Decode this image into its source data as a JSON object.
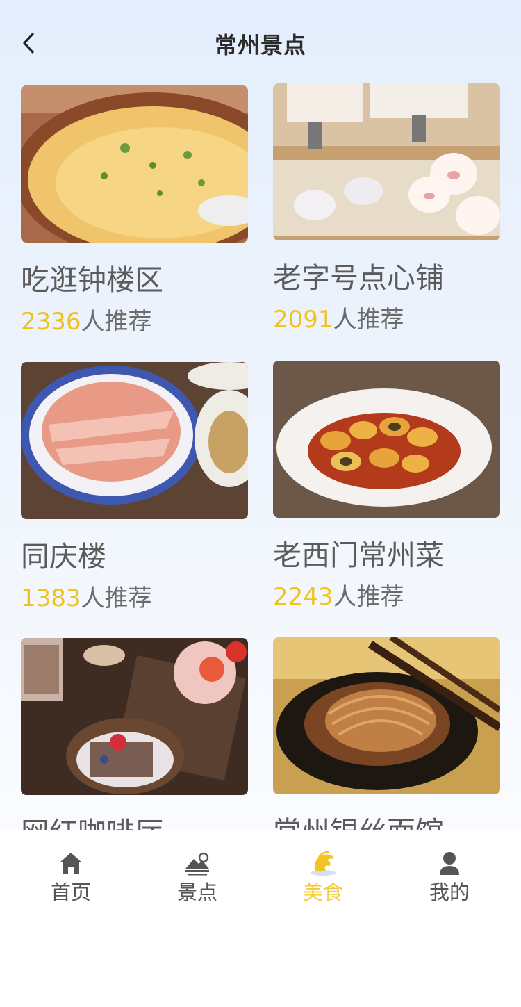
{
  "header": {
    "title": "常州景点",
    "back_icon": "chevron-left-icon"
  },
  "cards": [
    {
      "name": "吃逛钟楼区",
      "count": "2336",
      "suffix": "人推荐",
      "photo": "rice-porridge"
    },
    {
      "name": "老字号点心铺",
      "count": "2091",
      "suffix": "人推荐",
      "photo": "dim-sum-steamer"
    },
    {
      "name": "同庆楼",
      "count": "1383",
      "suffix": "人推荐",
      "photo": "sliced-pork-plate"
    },
    {
      "name": "老西门常州菜",
      "count": "2243",
      "suffix": "人推荐",
      "photo": "preserved-egg-dish"
    },
    {
      "name": "网红咖啡厅",
      "count": "",
      "suffix": "",
      "photo": "cafe-dessert-table"
    },
    {
      "name": "常州银丝面馆",
      "count": "",
      "suffix": "",
      "photo": "noodle-bowl"
    }
  ],
  "tabbar": {
    "items": [
      {
        "label": "首页",
        "icon": "home-icon",
        "active": false
      },
      {
        "label": "景点",
        "icon": "scenery-icon",
        "active": false
      },
      {
        "label": "美食",
        "icon": "food-icon",
        "active": true
      },
      {
        "label": "我的",
        "icon": "user-icon",
        "active": false
      }
    ]
  },
  "colors": {
    "accent": "#f1c21b",
    "text": "#5b5b5b",
    "title": "#2b2b2b"
  }
}
